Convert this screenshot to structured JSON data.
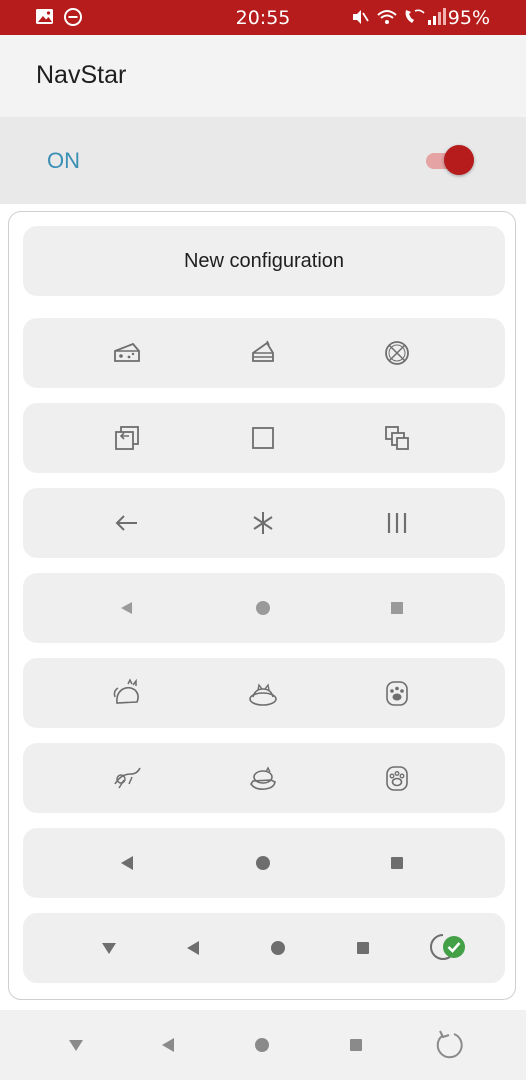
{
  "status_bar": {
    "time": "20:55",
    "battery": "95%",
    "background": "#b71c1c",
    "left_icons": [
      "gallery-icon",
      "do-not-disturb-icon"
    ],
    "right_icons": [
      "vibrate-icon",
      "wifi-icon",
      "wifi-calling-icon",
      "signal-icon"
    ]
  },
  "app_bar": {
    "title": "NavStar"
  },
  "toggle": {
    "label": "ON",
    "state": "on",
    "accent": "#b71c1c"
  },
  "new_config": {
    "label": "New configuration"
  },
  "icon_sets": [
    [
      "cheese-icon",
      "cake-slice-icon",
      "pizza-icon"
    ],
    [
      "back-frame-icon",
      "square-outline-icon",
      "overlap-squares-icon"
    ],
    [
      "arrow-left-icon",
      "asterisk-icon",
      "three-bars-icon"
    ],
    [
      "small-triangle-back-icon",
      "small-circle-home-icon",
      "small-square-recents-icon"
    ],
    [
      "cat-playing-icon",
      "cat-in-bed-icon",
      "paw-print-icon"
    ],
    [
      "cat-jumping-icon",
      "cat-sleeping-icon",
      "paw-print-alt-icon"
    ],
    [
      "triangle-back-icon",
      "circle-home-icon",
      "square-recents-icon"
    ],
    [
      "triangle-down-icon",
      "triangle-back-icon",
      "circle-home-icon",
      "square-recents-icon",
      "rotate-icon",
      "selected-check-icon"
    ]
  ],
  "nav_bar": {
    "icons": [
      "triangle-down-icon",
      "triangle-back-icon",
      "circle-home-icon",
      "square-recents-icon",
      "rotate-icon"
    ]
  }
}
